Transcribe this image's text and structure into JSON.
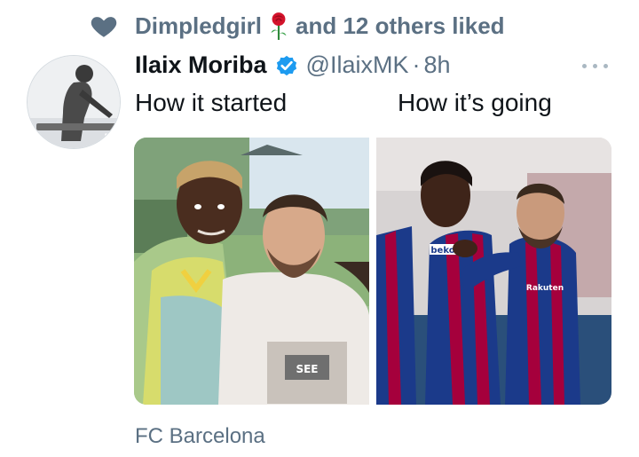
{
  "social_context": {
    "liker": "Dimpledgirl",
    "suffix": "and 12 others liked",
    "liker_emoji": "rose"
  },
  "tweet": {
    "author_name": "Ilaix Moriba",
    "handle": "@IlaixMK",
    "separator": "·",
    "time": "8h",
    "text_left": "How it started",
    "text_right": "How it’s going",
    "media": [
      {
        "kind": "photo",
        "description_name": "photo-young-boy-with-messi"
      },
      {
        "kind": "photo",
        "description_name": "photo-barcelona-players-celebrating"
      }
    ]
  },
  "footer": {
    "location": "FC Barcelona"
  },
  "icons": [
    "heart-icon",
    "rose-emoji-icon",
    "verified-badge-icon",
    "more-options-icon"
  ],
  "colors": {
    "secondary_text": "#5b7083",
    "primary_text": "#0f1419",
    "verified_blue": "#1d9bf0",
    "barca_blue": "#1b3a8a",
    "barca_red": "#a5003c"
  }
}
